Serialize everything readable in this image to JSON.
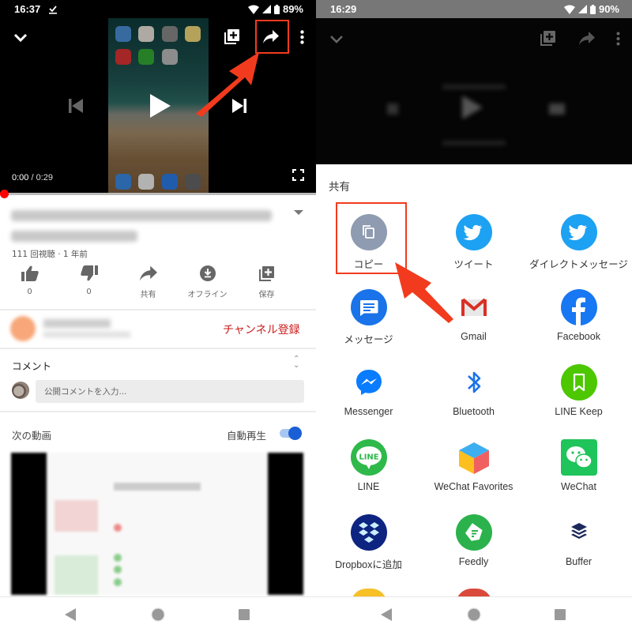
{
  "left_screen": {
    "status_bar": {
      "time": "16:37",
      "battery": "89%",
      "icons": [
        "download-done-icon",
        "wifi-icon",
        "signal-icon",
        "battery-icon"
      ]
    },
    "player": {
      "top_icons": [
        "collapse-chevron-icon",
        "add-to-playlist-icon",
        "share-icon",
        "more-vert-icon"
      ],
      "controls": [
        "previous-icon",
        "play-icon",
        "next-icon",
        "fullscreen-icon"
      ],
      "time_current": "0:00",
      "time_separator": " / ",
      "time_duration": "0:29",
      "progress": 0
    },
    "video": {
      "title": "(blurred)",
      "views": "111 回視聴 · 1 年前"
    },
    "actions": [
      {
        "icon": "thumb-up-icon",
        "label": "0"
      },
      {
        "icon": "thumb-down-icon",
        "label": "0"
      },
      {
        "icon": "share-icon",
        "label": "共有"
      },
      {
        "icon": "download-icon",
        "label": "オフライン"
      },
      {
        "icon": "add-to-playlist-icon",
        "label": "保存"
      }
    ],
    "channel": {
      "subscribe_label": "チャンネル登録"
    },
    "comments": {
      "heading": "コメント",
      "input_placeholder": "公開コメントを入力..."
    },
    "up_next": {
      "heading": "次の動画",
      "autoplay_label": "自動再生",
      "autoplay_on": true
    }
  },
  "right_screen": {
    "status_bar": {
      "time": "16:29",
      "battery": "90%"
    },
    "share_sheet": {
      "title": "共有",
      "targets": [
        {
          "label": "コピー",
          "icon": "copy-icon",
          "color": "#8e9bb0"
        },
        {
          "label": "ツイート",
          "icon": "twitter-icon",
          "color": "#1da1f2"
        },
        {
          "label": "ダイレクトメッセージ",
          "icon": "twitter-icon",
          "color": "#1da1f2"
        },
        {
          "label": "メッセージ",
          "icon": "messages-icon",
          "color": "#1a73e8"
        },
        {
          "label": "Gmail",
          "icon": "gmail-icon",
          "color": "#d93025"
        },
        {
          "label": "Facebook",
          "icon": "facebook-icon",
          "color": "#1877f2"
        },
        {
          "label": "Messenger",
          "icon": "messenger-icon",
          "color": "#0a7cff"
        },
        {
          "label": "Bluetooth",
          "icon": "bluetooth-icon",
          "color": "#1a73e8"
        },
        {
          "label": "LINE Keep",
          "icon": "line-keep-icon",
          "color": "#4cc700"
        },
        {
          "label": "LINE",
          "icon": "line-icon",
          "color": "#2eb94a"
        },
        {
          "label": "WeChat Favorites",
          "icon": "wechat-favorites-icon",
          "color": "#3daef0"
        },
        {
          "label": "WeChat",
          "icon": "wechat-icon",
          "color": "#1fc45a"
        },
        {
          "label": "Dropboxに追加",
          "icon": "dropbox-icon",
          "color": "#0d2481"
        },
        {
          "label": "Feedly",
          "icon": "feedly-icon",
          "color": "#2bb24c"
        },
        {
          "label": "Buffer",
          "icon": "buffer-icon",
          "color": "#1c2a5a"
        }
      ]
    }
  },
  "nav_bar": {
    "buttons": [
      "back-icon",
      "home-icon",
      "recents-icon"
    ]
  },
  "annotations": {
    "color": "#f23b1e"
  }
}
